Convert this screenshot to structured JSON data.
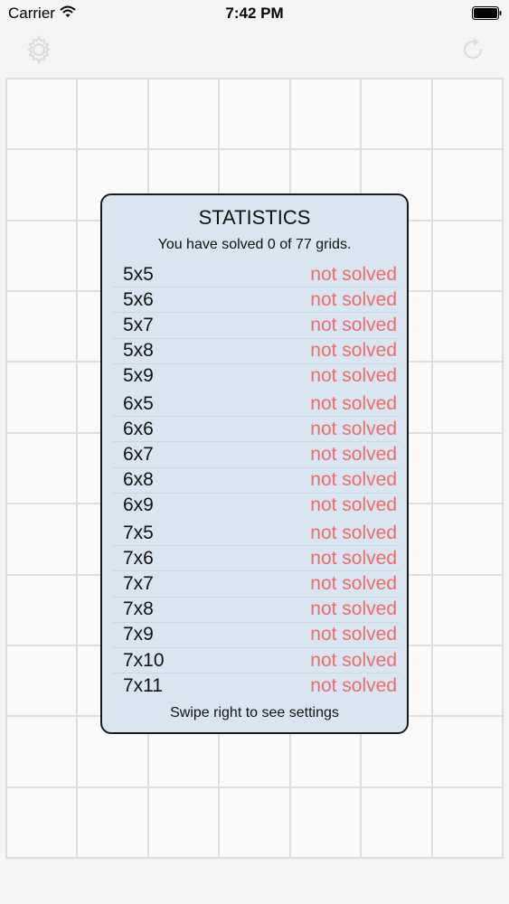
{
  "status_bar": {
    "carrier": "Carrier",
    "time": "7:42 PM"
  },
  "toolbar": {
    "settings_icon": "gear-icon",
    "reload_icon": "refresh-icon"
  },
  "stats": {
    "title": "STATISTICS",
    "summary": "You have solved 0 of 77 grids.",
    "footer": "Swipe right to see settings",
    "groups": [
      [
        {
          "size": "5x5",
          "status": "not solved"
        },
        {
          "size": "5x6",
          "status": "not solved"
        },
        {
          "size": "5x7",
          "status": "not solved"
        },
        {
          "size": "5x8",
          "status": "not solved"
        },
        {
          "size": "5x9",
          "status": "not solved"
        }
      ],
      [
        {
          "size": "6x5",
          "status": "not solved"
        },
        {
          "size": "6x6",
          "status": "not solved"
        },
        {
          "size": "6x7",
          "status": "not solved"
        },
        {
          "size": "6x8",
          "status": "not solved"
        },
        {
          "size": "6x9",
          "status": "not solved"
        }
      ],
      [
        {
          "size": "7x5",
          "status": "not solved"
        },
        {
          "size": "7x6",
          "status": "not solved"
        },
        {
          "size": "7x7",
          "status": "not solved"
        },
        {
          "size": "7x8",
          "status": "not solved"
        },
        {
          "size": "7x9",
          "status": "not solved"
        },
        {
          "size": "7x10",
          "status": "not solved"
        },
        {
          "size": "7x11",
          "status": "not solved"
        }
      ]
    ]
  },
  "colors": {
    "not_solved": "#ef6b6b",
    "panel_bg": "#d9e6f1",
    "grid_line": "#dedede"
  }
}
